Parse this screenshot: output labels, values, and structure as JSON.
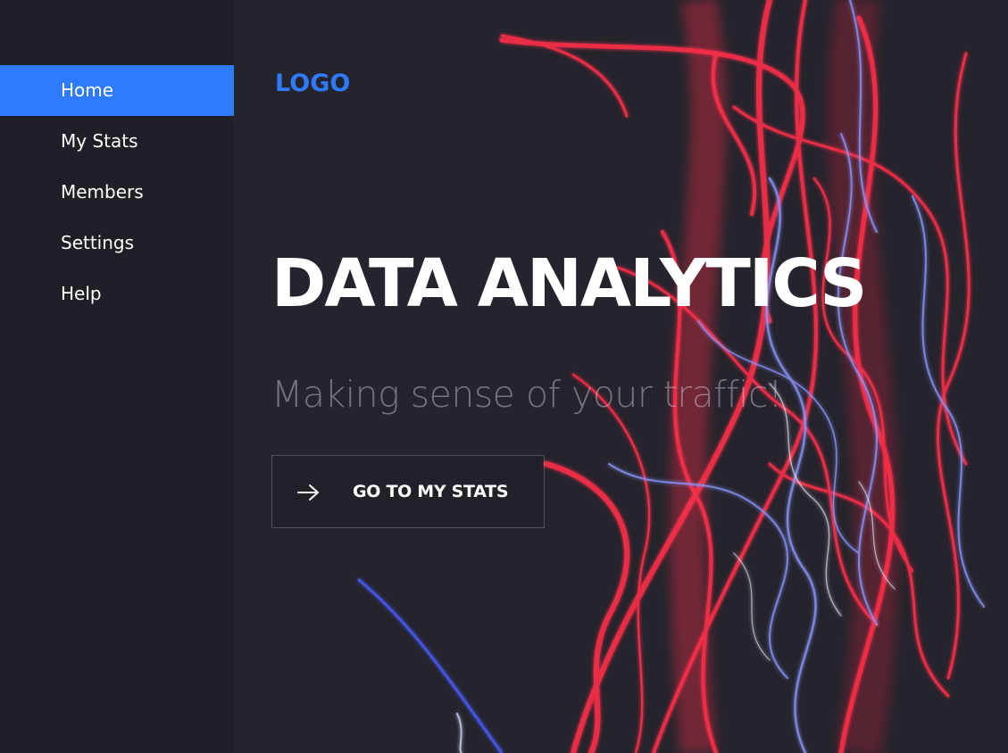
{
  "sidebar": {
    "items": [
      {
        "label": "Home",
        "active": true
      },
      {
        "label": "My Stats",
        "active": false
      },
      {
        "label": "Members",
        "active": false
      },
      {
        "label": "Settings",
        "active": false
      },
      {
        "label": "Help",
        "active": false
      }
    ]
  },
  "header": {
    "logo": "LOGO"
  },
  "hero": {
    "title": "DATA ANALYTICS",
    "subtitle": "Making sense of your traffic!",
    "cta_label": "GO TO MY STATS",
    "cta_icon": "arrow-right-icon"
  },
  "colors": {
    "accent": "#2f7bff",
    "sidebar_bg": "#201f27",
    "main_bg": "#25242c",
    "light_red": "#ff2f4a",
    "light_blue": "#7a8cff"
  }
}
